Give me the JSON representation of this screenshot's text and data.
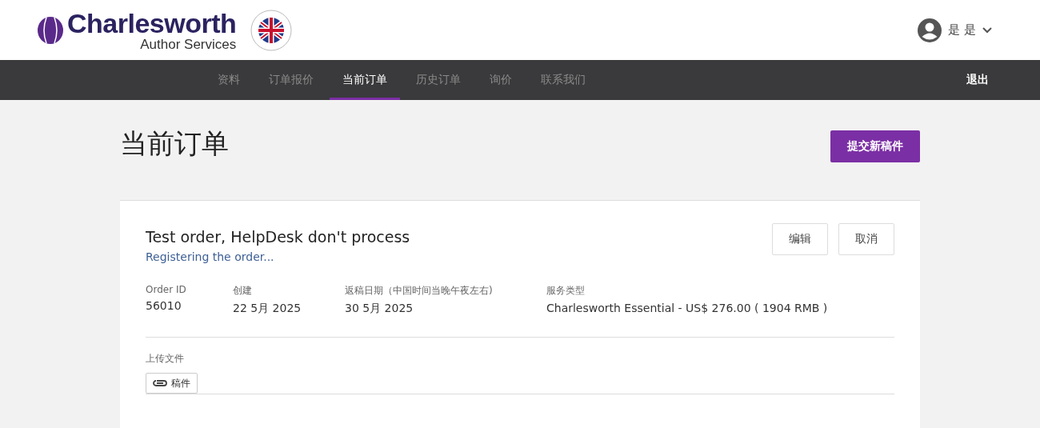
{
  "logo": {
    "name": "Charlesworth",
    "tagline": "Author Services"
  },
  "user": {
    "name": "是 是"
  },
  "nav": {
    "items": [
      {
        "label": "资料",
        "selected": false
      },
      {
        "label": "订单报价",
        "selected": false
      },
      {
        "label": "当前订单",
        "selected": true
      },
      {
        "label": "历史订单",
        "selected": false
      },
      {
        "label": "询价",
        "selected": false
      },
      {
        "label": "联系我们",
        "selected": false
      }
    ],
    "logout": "退出"
  },
  "page": {
    "title": "当前订单",
    "submit_button": "提交新稿件"
  },
  "order": {
    "title": "Test order, HelpDesk don't process",
    "status": "Registering the order...",
    "buttons": [
      "编辑",
      "取消"
    ],
    "fields": [
      {
        "label": "Order ID",
        "value": "56010"
      },
      {
        "label": "创建",
        "value": "22 5月 2025"
      },
      {
        "label": "返稿日期（中国时间当晚午夜左右)",
        "value": "30 5月 2025"
      },
      {
        "label": "服务类型",
        "value": "Charlesworth Essential - US$ 276.00 ( 1904 RMB )"
      }
    ],
    "uploads": {
      "label": "上传文件",
      "files": [
        "稿件"
      ]
    }
  }
}
